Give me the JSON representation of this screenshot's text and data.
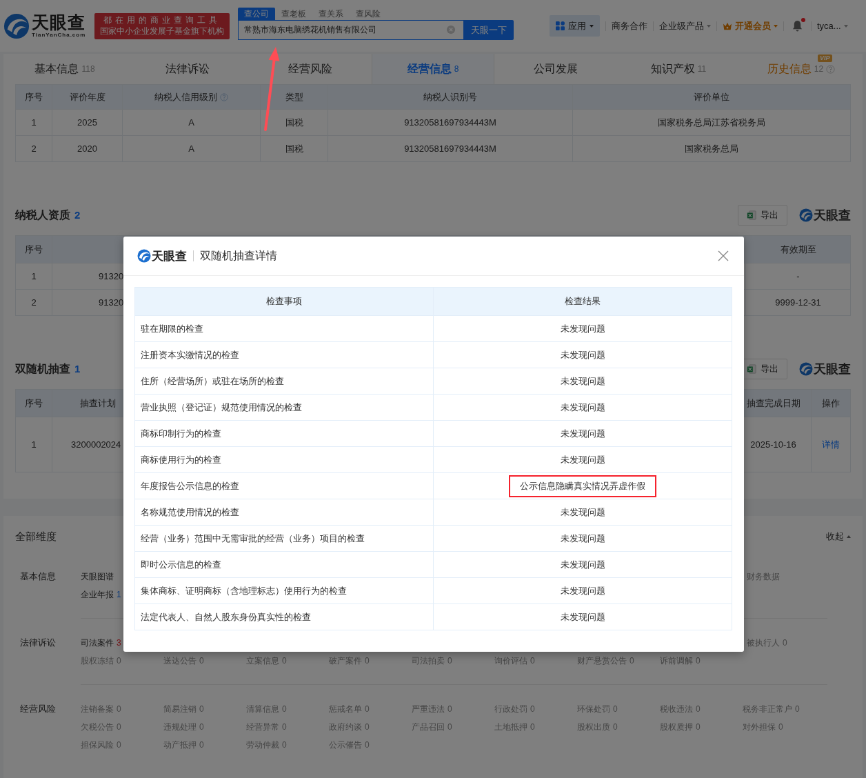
{
  "header": {
    "logo": {
      "name": "天眼查",
      "domain": "TianYanCha.com"
    },
    "slogan": [
      "都在用的商业查询工具",
      "国家中小企业发展子基金旗下机构"
    ],
    "search": {
      "tabs": [
        {
          "label": "查公司",
          "selected": true
        },
        {
          "label": "查老板",
          "selected": false
        },
        {
          "label": "查关系",
          "selected": false
        },
        {
          "label": "查风险",
          "selected": false
        }
      ],
      "value": "常熟市海东电脑绣花机销售有限公司",
      "button": "天眼一下"
    },
    "nav": [
      {
        "kind": "apps",
        "label": "应用"
      },
      {
        "kind": "link",
        "label": "商务合作"
      },
      {
        "kind": "dropdown",
        "label": "企业级产品"
      },
      {
        "kind": "vip",
        "label": "开通会员"
      },
      {
        "kind": "bell",
        "unread": true
      },
      {
        "kind": "user",
        "label": "tyca..."
      }
    ]
  },
  "tabs": [
    {
      "label": "基本信息",
      "count": "118",
      "selected": false
    },
    {
      "label": "法律诉讼",
      "selected": false
    },
    {
      "label": "经营风险",
      "selected": false
    },
    {
      "label": "经营信息",
      "count": "8",
      "selected": true
    },
    {
      "label": "公司发展",
      "selected": false
    },
    {
      "label": "知识产权",
      "count": "11",
      "selected": false
    },
    {
      "label": "历史信息",
      "count": "12",
      "selected": false,
      "badge": "VIP"
    }
  ],
  "credit_table": {
    "columns": [
      {
        "label": "序号"
      },
      {
        "label": "评价年度"
      },
      {
        "label": "纳税人信用级别",
        "help": true
      },
      {
        "label": "类型"
      },
      {
        "label": "纳税人识别号"
      },
      {
        "label": "评价单位"
      }
    ],
    "rows": [
      [
        "1",
        "2025",
        "A",
        "国税",
        "91320581697934443M",
        "国家税务总局江苏省税务局"
      ],
      [
        "2",
        "2020",
        "A",
        "国税",
        "91320581697934443M",
        "国家税务总局"
      ]
    ]
  },
  "taxpayer_qualification": {
    "title": "纳税人资质",
    "count": "2",
    "export": "导出",
    "logo": "天眼查",
    "columns": [
      "序号",
      "有效期至"
    ],
    "rows": [
      {
        "index": "1",
        "column_2": "91320",
        "valid_until": "-"
      },
      {
        "index": "2",
        "column_2": "91320",
        "valid_until": "9999-12-31"
      }
    ]
  },
  "random_inspection": {
    "title": "双随机抽查",
    "count": "1",
    "export": "导出",
    "logo": "天眼查",
    "columns": [
      "序号",
      "抽查计划",
      "抽查完成日期",
      "操作"
    ],
    "rows": [
      {
        "index": "1",
        "plan_no": "3200002024",
        "completed": "2025-10-16",
        "action": "详情"
      }
    ]
  },
  "dimensions": {
    "title": "全部维度",
    "toggle": "收起",
    "groups": [
      {
        "label": "基本信息",
        "rows": [
          {
            "items": [
              {
                "name": "天眼图谱"
              }
            ],
            "trailing": [
              {
                "name": "财务数据",
                "disabled": true
              }
            ]
          },
          {
            "items": [
              {
                "name": "企业年报",
                "count": "1",
                "color": "#0b3b80"
              }
            ]
          }
        ]
      },
      {
        "label": "法律诉讼",
        "rows": [
          {
            "items": [
              {
                "name": "司法案件",
                "count": "3",
                "color": "#7a1116"
              }
            ],
            "trailing": [
              {
                "name": "被执行人",
                "count": "0",
                "disabled": true
              }
            ]
          },
          {
            "items": [
              {
                "name": "股权冻结",
                "count": "0",
                "disabled": true
              },
              {
                "name": "送达公告",
                "count": "0",
                "disabled": true
              },
              {
                "name": "立案信息",
                "count": "0",
                "disabled": true
              },
              {
                "name": "破产案件",
                "count": "0",
                "disabled": true
              },
              {
                "name": "司法拍卖",
                "count": "0",
                "disabled": true
              },
              {
                "name": "询价评估",
                "count": "0",
                "disabled": true
              },
              {
                "name": "财产悬赏公告",
                "count": "0",
                "disabled": true
              },
              {
                "name": "诉前调解",
                "count": "0",
                "disabled": true
              }
            ]
          }
        ]
      },
      {
        "label": "经营风险",
        "rows": [
          {
            "items": [
              {
                "name": "注销备案",
                "count": "0",
                "disabled": true
              },
              {
                "name": "简易注销",
                "count": "0",
                "disabled": true
              },
              {
                "name": "清算信息",
                "count": "0",
                "disabled": true
              },
              {
                "name": "惩戒名单",
                "count": "0",
                "disabled": true
              },
              {
                "name": "严重违法",
                "count": "0",
                "disabled": true
              },
              {
                "name": "行政处罚",
                "count": "0",
                "disabled": true
              },
              {
                "name": "环保处罚",
                "count": "0",
                "disabled": true
              },
              {
                "name": "税收违法",
                "count": "0",
                "disabled": true
              },
              {
                "name": "税务非正常户",
                "count": "0",
                "disabled": true
              }
            ]
          },
          {
            "items": [
              {
                "name": "欠税公告",
                "count": "0",
                "disabled": true
              },
              {
                "name": "违规处理",
                "count": "0",
                "disabled": true
              },
              {
                "name": "经营异常",
                "count": "0",
                "disabled": true
              },
              {
                "name": "政府约谈",
                "count": "0",
                "disabled": true
              },
              {
                "name": "产品召回",
                "count": "0",
                "disabled": true
              },
              {
                "name": "土地抵押",
                "count": "0",
                "disabled": true
              },
              {
                "name": "股权出质",
                "count": "0",
                "disabled": true
              },
              {
                "name": "股权质押",
                "count": "0",
                "disabled": true
              },
              {
                "name": "对外担保",
                "count": "0",
                "disabled": true
              }
            ]
          },
          {
            "items": [
              {
                "name": "担保风险",
                "count": "0",
                "disabled": true
              },
              {
                "name": "动产抵押",
                "count": "0",
                "disabled": true
              },
              {
                "name": "劳动仲裁",
                "count": "0",
                "disabled": true
              },
              {
                "name": "公示催告",
                "count": "0",
                "disabled": true
              }
            ]
          }
        ]
      }
    ]
  },
  "modal": {
    "logo": "天眼查",
    "title": "双随机抽查详情",
    "columns": [
      "检查事项",
      "检查结果"
    ],
    "rows": [
      {
        "item": "驻在期限的检查",
        "result": "未发现问题",
        "highlighted": false
      },
      {
        "item": "注册资本实缴情况的检查",
        "result": "未发现问题",
        "highlighted": false
      },
      {
        "item": "住所（经营场所）或驻在场所的检查",
        "result": "未发现问题",
        "highlighted": false
      },
      {
        "item": "营业执照（登记证）规范使用情况的检查",
        "result": "未发现问题",
        "highlighted": false
      },
      {
        "item": "商标印制行为的检查",
        "result": "未发现问题",
        "highlighted": false
      },
      {
        "item": "商标使用行为的检查",
        "result": "未发现问题",
        "highlighted": false
      },
      {
        "item": "年度报告公示信息的检查",
        "result": "公示信息隐瞒真实情况弄虚作假",
        "highlighted": true
      },
      {
        "item": "名称规范使用情况的检查",
        "result": "未发现问题",
        "highlighted": false
      },
      {
        "item": "经营（业务）范围中无需审批的经营（业务）项目的检查",
        "result": "未发现问题",
        "highlighted": false
      },
      {
        "item": "即时公示信息的检查",
        "result": "未发现问题",
        "highlighted": false
      },
      {
        "item": "集体商标、证明商标（含地理标志）使用行为的检查",
        "result": "未发现问题",
        "highlighted": false
      },
      {
        "item": "法定代表人、自然人股东身份真实性的检查",
        "result": "未发现问题",
        "highlighted": false
      }
    ]
  }
}
